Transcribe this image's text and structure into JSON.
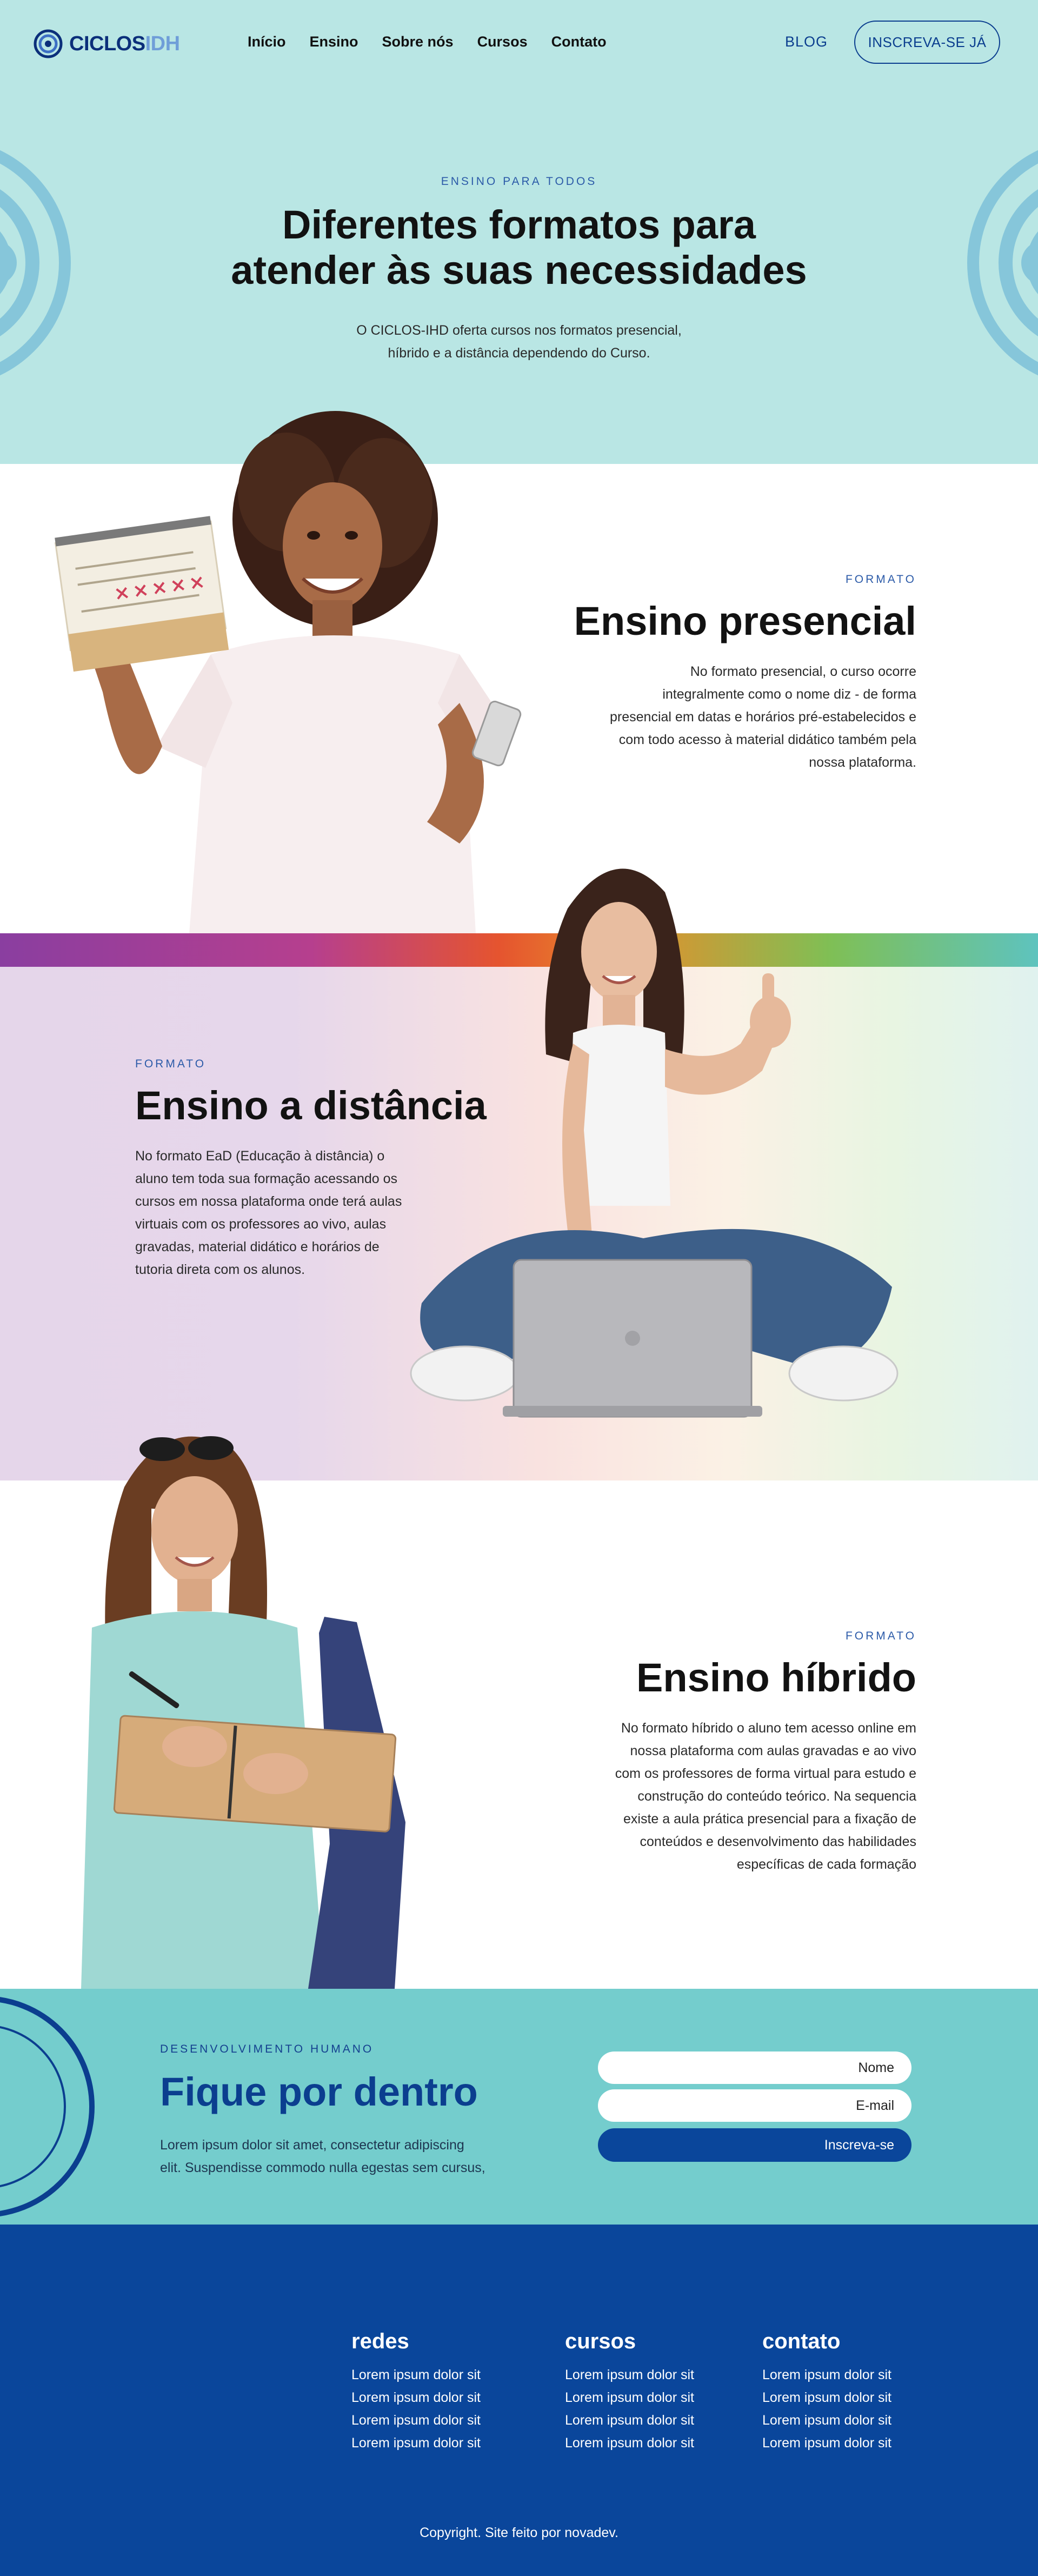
{
  "brand": {
    "logo_part1": "CICLOS",
    "logo_part2": "IDH"
  },
  "nav": {
    "items": [
      "Início",
      "Ensino",
      "Sobre nós",
      "Cursos",
      "Contato"
    ],
    "blog": "BLOG",
    "cta": "INSCREVA-SE JÁ"
  },
  "hero": {
    "eyebrow": "ENSINO PARA TODOS",
    "title_line1": "Diferentes formatos para",
    "title_line2": "atender às suas necessidades",
    "sub_line1": "O CICLOS-IHD oferta cursos nos formatos presencial,",
    "sub_line2": "híbrido e a distância dependendo do Curso."
  },
  "presencial": {
    "eyebrow": "FORMATO",
    "title": "Ensino presencial",
    "lines": [
      "No formato presencial, o curso ocorre",
      "integralmente como o nome diz - de forma",
      "presencial em datas e horários pré-estabelecidos e",
      "com todo acesso à material didático também pela",
      "nossa plataforma."
    ]
  },
  "distancia": {
    "eyebrow": "FORMATO",
    "title": "Ensino a distância",
    "lines": [
      "No formato EaD (Educação à distância) o",
      "aluno tem toda sua formação acessando os",
      "cursos em nossa plataforma onde terá aulas",
      "virtuais com os professores ao vivo, aulas",
      "gravadas, material didático e horários de",
      "tutoria direta com os alunos."
    ]
  },
  "hibrido": {
    "eyebrow": "FORMATO",
    "title": "Ensino híbrido",
    "lines": [
      "No formato híbrido o aluno tem acesso online em",
      "nossa plataforma com aulas gravadas e ao vivo",
      "com os professores de forma virtual para estudo e",
      "construção do conteúdo teórico. Na sequencia",
      "existe a aula prática presencial para a fixação de",
      "conteúdos e desenvolvimento das habilidades",
      "específicas de cada formação"
    ]
  },
  "newsletter": {
    "eyebrow": "DESENVOLVIMENTO HUMANO",
    "title": "Fique por dentro",
    "text_line1": "Lorem ipsum dolor sit amet, consectetur adipiscing",
    "text_line2": "elit. Suspendisse commodo nulla egestas sem cursus,",
    "name_placeholder": "Nome",
    "email_placeholder": "E-mail",
    "button": "Inscreva-se"
  },
  "footer": {
    "columns": [
      {
        "title": "redes",
        "items": [
          "Lorem ipsum dolor sit",
          "Lorem ipsum dolor sit",
          "Lorem ipsum dolor sit",
          "Lorem ipsum dolor sit"
        ]
      },
      {
        "title": "cursos",
        "items": [
          "Lorem ipsum dolor sit",
          "Lorem ipsum dolor sit",
          "Lorem ipsum dolor sit",
          "Lorem ipsum dolor sit"
        ]
      },
      {
        "title": "contato",
        "items": [
          "Lorem ipsum dolor sit",
          "Lorem ipsum dolor sit",
          "Lorem ipsum dolor sit",
          "Lorem ipsum dolor sit"
        ]
      }
    ],
    "copyright": "Copyright. Site feito por novadev."
  },
  "colors": {
    "hero_bg": "#b9e6e4",
    "brand_blue": "#0a469b",
    "news_bg": "#74cdcd",
    "accent": "#2b5aa8"
  },
  "icons": [
    "spiral-logo-icon",
    "concentric-circles-decoration",
    "photo-student-calendar",
    "photo-student-laptop",
    "photo-student-notebook"
  ]
}
